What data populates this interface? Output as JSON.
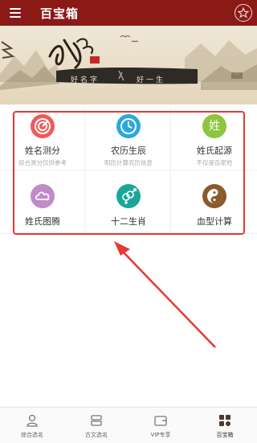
{
  "header": {
    "title": "百宝箱",
    "menu_icon": "menu-icon",
    "favorite_icon": "star-icon"
  },
  "banner": {
    "logo_text": "起名大师",
    "name_label": "好名字",
    "life_label": "好一生"
  },
  "grid": {
    "items": [
      {
        "title": "姓名测分",
        "subtitle": "综合测分仅供参考",
        "icon": "target-icon",
        "color": "#ef5b5b"
      },
      {
        "title": "农历生辰",
        "subtitle": "阳历计算农历信息",
        "icon": "clock-icon",
        "color": "#29a9e0"
      },
      {
        "title": "姓氏起源",
        "subtitle": "不仅是百家姓",
        "icon": "surname-icon",
        "glyph": "姓",
        "color": "#8cc63f"
      },
      {
        "title": "姓氏图腾",
        "subtitle": "",
        "icon": "cloud-icon",
        "color": "#c18ac9"
      },
      {
        "title": "十二生肖",
        "subtitle": "",
        "icon": "gender-icon",
        "color": "#1aa79a"
      },
      {
        "title": "血型计算",
        "subtitle": "",
        "icon": "yin-yang-icon",
        "color": "#8a5a2b"
      }
    ]
  },
  "bottom_nav": {
    "items": [
      {
        "label": "综合选名",
        "icon": "person-icon"
      },
      {
        "label": "古文选名",
        "icon": "book-icon"
      },
      {
        "label": "VIP专享",
        "icon": "wallet-icon"
      },
      {
        "label": "百宝箱",
        "icon": "grid-icon"
      }
    ],
    "active_index": 3
  },
  "colors": {
    "header_bg": "#8b1a17",
    "highlight": "#e53935"
  }
}
